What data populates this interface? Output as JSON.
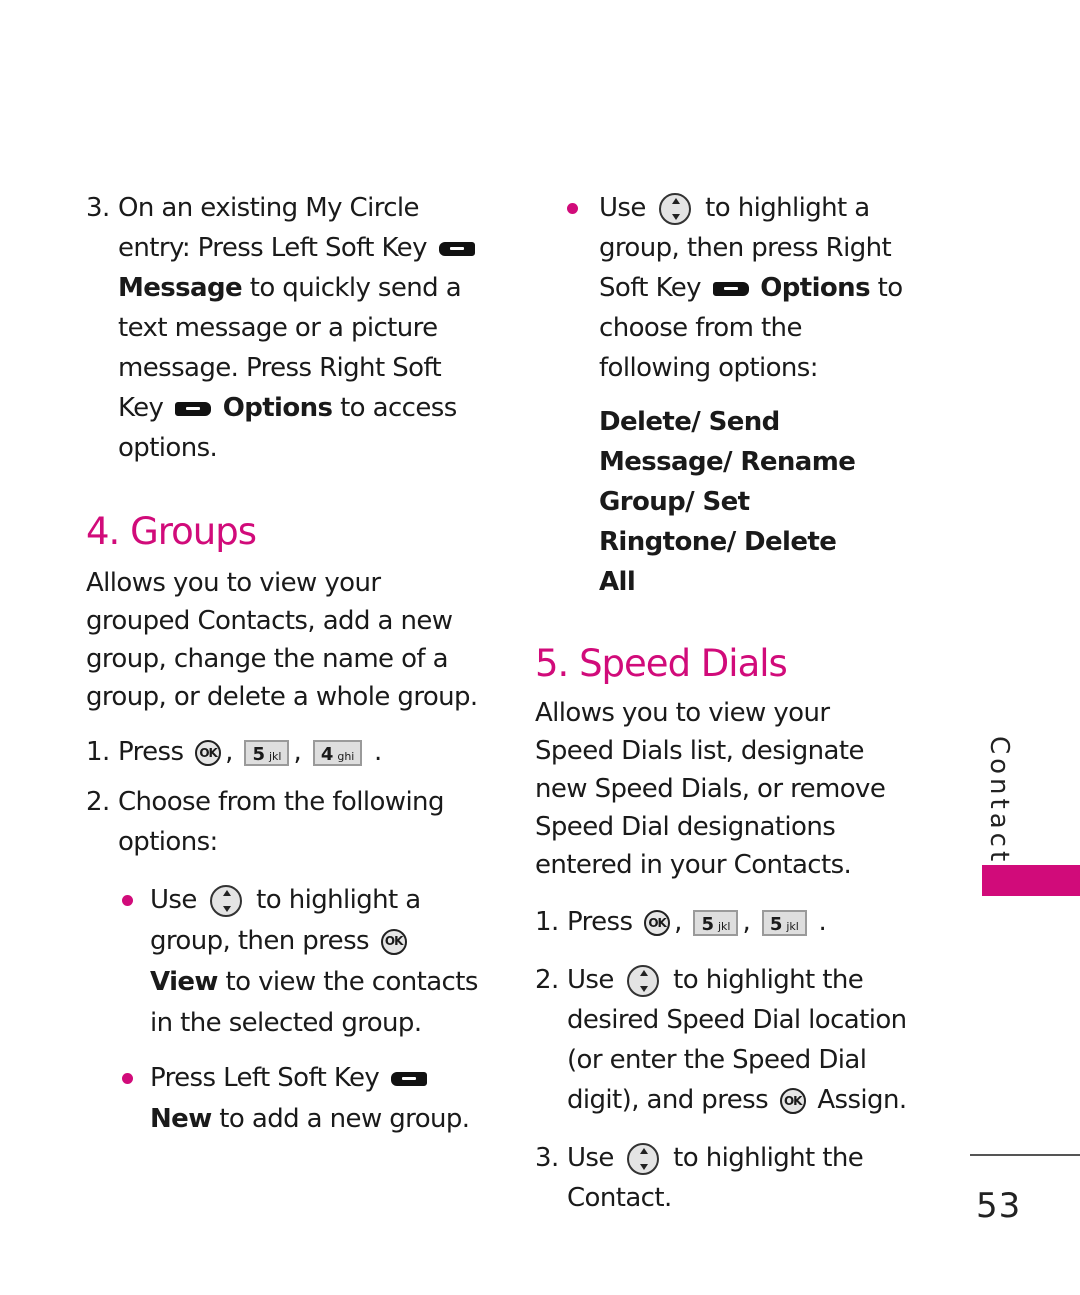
{
  "left": {
    "step3": {
      "num": "3.",
      "t1": "On an existing My Circle entry: Press Left Soft Key",
      "b1": "Message",
      "t2": "to quickly send a text message or a picture message. Press Right Soft Key",
      "b2": "Options",
      "t3": "to access options."
    },
    "groups": {
      "heading": "4. Groups",
      "description": "Allows you to view your grouped Contacts, add a new group, change the name of a group, or delete a whole group.",
      "step1": {
        "num": "1.",
        "press": "Press",
        "ok": "OK",
        "sep": ",",
        "key1_digit": "5",
        "key1_letters": "jkl",
        "key2_digit": "4",
        "key2_letters": "ghi",
        "end": "."
      },
      "step2": {
        "num": "2.",
        "text": "Choose from the following options:"
      },
      "bullet1": {
        "t1": "Use",
        "t2": "to highlight a group, then press",
        "ok": "OK",
        "b1": "View",
        "t3": "to view the contacts in the selected group."
      },
      "bullet2": {
        "t1": "Press Left Soft Key",
        "b1": "New",
        "t2": "to add a new group."
      }
    }
  },
  "right": {
    "bullet": {
      "t1": "Use",
      "t2": "to highlight a group, then press Right Soft Key",
      "b1": "Options",
      "t3": "to choose from the following options:"
    },
    "options_list": "Delete/ Send Message/ Rename Group/ Set Ringtone/ Delete All",
    "speed_dials": {
      "heading": "5. Speed Dials",
      "description": "Allows you to view your Speed Dials list, designate new Speed Dials, or remove Speed Dial designations entered in your Contacts.",
      "step1": {
        "num": "1.",
        "press": "Press",
        "ok": "OK",
        "sep": ",",
        "key1_digit": "5",
        "key1_letters": "jkl",
        "key2_digit": "5",
        "key2_letters": "jkl",
        "end": "."
      },
      "step2": {
        "num": "2.",
        "t1": "Use",
        "t2": "to highlight the desired Speed Dial location (or enter the Speed Dial digit), and press",
        "ok": "OK",
        "t3": "Assign."
      },
      "step3": {
        "num": "3.",
        "t1": "Use",
        "t2": "to highlight the Contact."
      }
    }
  },
  "sidebar": {
    "section_label": "Contacts",
    "accent_color": "#d10b7a"
  },
  "page_number": "53"
}
